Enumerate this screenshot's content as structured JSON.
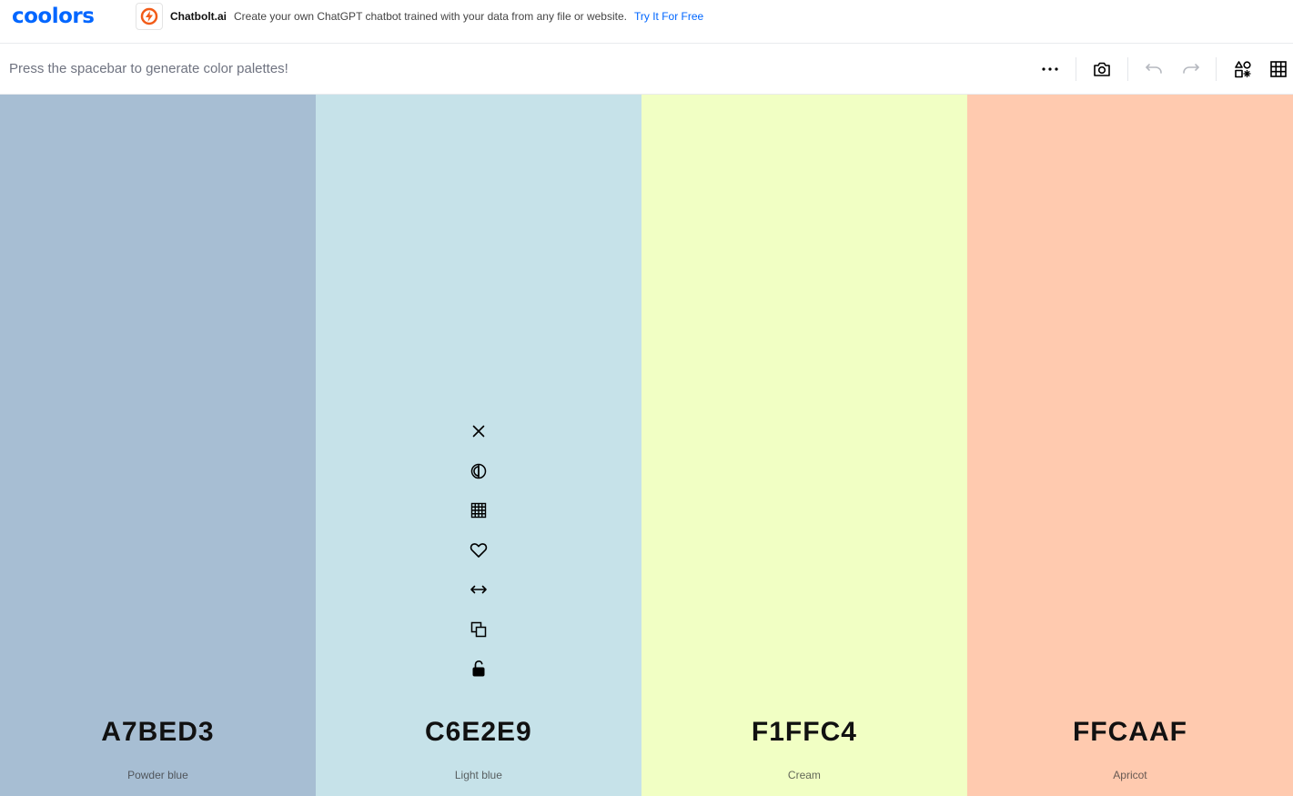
{
  "brand": {
    "logo": "coolors",
    "accent": "#0066ff"
  },
  "ad": {
    "brand": "Chatbolt.ai",
    "text": "Create your own ChatGPT chatbot trained with your data from any file or website.",
    "link": "Try It For Free",
    "icon": "chatbolt-logo-icon",
    "icon_color": "#f25c19"
  },
  "toolbar": {
    "hint": "Press the spacebar to generate color palettes!",
    "buttons": [
      "more-icon",
      "camera-icon",
      "undo-icon",
      "redo-icon",
      "shapes-icon",
      "grid-icon"
    ]
  },
  "palette": {
    "colors": [
      {
        "hex": "A7BED3",
        "name": "Powder blue",
        "color": "#a7bed3"
      },
      {
        "hex": "C6E2E9",
        "name": "Light blue",
        "color": "#c6e2e9"
      },
      {
        "hex": "F1FFC4",
        "name": "Cream",
        "color": "#f1ffc4"
      },
      {
        "hex": "FFCAAF",
        "name": "Apricot",
        "color": "#ffcaaf"
      }
    ],
    "hover_tools": [
      "close-icon",
      "contrast-icon",
      "shades-grid-icon",
      "heart-icon",
      "drag-arrows-icon",
      "copy-icon",
      "unlock-icon"
    ]
  }
}
